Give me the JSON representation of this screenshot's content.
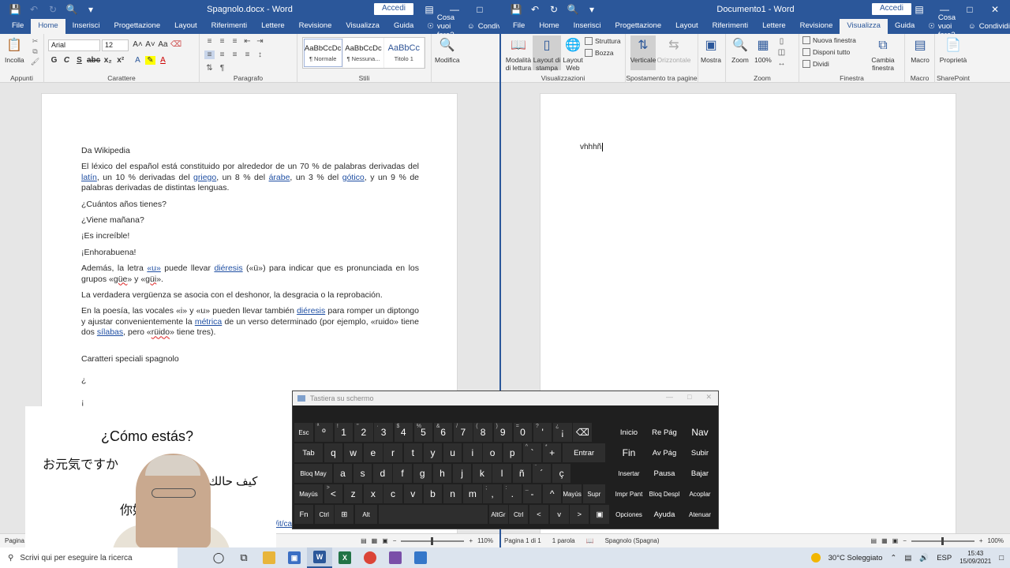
{
  "left_window": {
    "title": "Spagnolo.docx - Word",
    "accedi": "Accedi",
    "tabs": [
      "File",
      "Home",
      "Inserisci",
      "Progettazione",
      "Layout",
      "Riferimenti",
      "Lettere",
      "Revisione",
      "Visualizza",
      "Guida"
    ],
    "active_tab": "Home",
    "help": "Cosa vuoi fare?",
    "share": "Condividi",
    "ribbon": {
      "paste": "Incolla",
      "clipboard_group": "Appunti",
      "font_name": "Arial",
      "font_size": "12",
      "font_group": "Carattere",
      "paragraph_group": "Paragrafo",
      "styles": [
        {
          "preview": "AaBbCcDc",
          "name": "¶ Normale"
        },
        {
          "preview": "AaBbCcDc",
          "name": "¶ Nessuna..."
        },
        {
          "preview": "AaBbCc",
          "name": "Titolo 1"
        }
      ],
      "styles_group": "Stili",
      "edit": "Modifica"
    },
    "status": {
      "page": "Pagina",
      "zoom": "110%"
    },
    "document": {
      "p1": "Da Wikipedia",
      "p2": {
        "a": "El léxico del español está constituido por alrededor de un 70 % de palabras derivadas del ",
        "l1": "latín",
        "b": ", un 10 % derivadas del ",
        "l2": "griego",
        "c": ", un 8 % del ",
        "l3": "árabe",
        "d": ", un 3 % del ",
        "l4": "gótico",
        "e": ", y un 9 % de palabras derivadas de distintas lenguas."
      },
      "p3": "¿Cuántos años tienes?",
      "p4": "¿Viene mañana?",
      "p5": "¡Es increíble!",
      "p6": "¡Enhorabuena!",
      "p7": {
        "a": "Además, la letra ",
        "l1": "«u»",
        "b": " puede llevar ",
        "l2": "diéresis",
        "c": " («ü») para indicar que es pronunciada en los grupos «",
        "s1": "güe",
        "d": "» y «",
        "s2": "güi",
        "e": "»."
      },
      "p8": "La verdadera vergüenza se asocia con el deshonor, la desgracia o la reprobación.",
      "p9": {
        "a": "En la poesía, las vocales «i» y «u» pueden llevar también ",
        "l1": "diéresis",
        "b": " para romper un diptongo y ajustar convenientemente la ",
        "l2": "métrica",
        "c": " de un verso determinado (por ejemplo, «ruido» tiene dos ",
        "l3": "sílabas",
        "d": ", pero «",
        "s1": "rüido",
        "e": "» tiene tres)."
      },
      "p10": "Caratteri speciali spagnolo",
      "p11": "¿",
      "p12": "¡",
      "url_fragment": "/it/ca"
    }
  },
  "right_window": {
    "title": "Documento1 - Word",
    "accedi": "Accedi",
    "tabs": [
      "File",
      "Home",
      "Inserisci",
      "Progettazione",
      "Layout",
      "Riferimenti",
      "Lettere",
      "Revisione",
      "Visualizza",
      "Guida"
    ],
    "active_tab": "Visualizza",
    "help": "Cosa vuoi fare?",
    "share": "Condividi",
    "ribbon": {
      "reading_mode": "Modalità di lettura",
      "print_layout": "Layout di stampa",
      "web_layout": "Layout Web",
      "structure": "Struttura",
      "draft": "Bozza",
      "views_group": "Visualizzazioni",
      "vertical": "Verticale",
      "horizontal": "Orizzontale",
      "page_move_group": "Spostamento tra pagine",
      "show": "Mostra",
      "zoom": "Zoom",
      "zoom100": "100%",
      "zoom_group": "Zoom",
      "new_window": "Nuova finestra",
      "arrange_all": "Disponi tutto",
      "split": "Dividi",
      "switch_windows": "Cambia finestra",
      "window_group": "Finestra",
      "macro": "Macro",
      "macro_group": "Macro",
      "properties": "Proprietà",
      "sharepoint_group": "SharePoint"
    },
    "document_text": "vhhhñ",
    "status": {
      "page": "Pagina 1 di 1",
      "words": "1 parola",
      "language": "Spagnolo (Spagna)",
      "zoom": "100%"
    }
  },
  "keyboard": {
    "title": "Tastiera su schermo",
    "row1": [
      {
        "m": "Esc"
      },
      {
        "s": "ª",
        "m": "º"
      },
      {
        "s": "!",
        "m": "1"
      },
      {
        "s": "\"",
        "m": "2"
      },
      {
        "s": "·",
        "m": "3"
      },
      {
        "s": "$",
        "m": "4"
      },
      {
        "s": "%",
        "m": "5"
      },
      {
        "s": "&",
        "m": "6"
      },
      {
        "s": "/",
        "m": "7"
      },
      {
        "s": "(",
        "m": "8"
      },
      {
        "s": ")",
        "m": "9"
      },
      {
        "s": "=",
        "m": "0"
      },
      {
        "s": "?",
        "m": "'"
      },
      {
        "s": "¿",
        "m": "¡"
      },
      {
        "m": "⌫"
      }
    ],
    "row2": [
      {
        "m": "Tab"
      },
      {
        "m": "q"
      },
      {
        "m": "w"
      },
      {
        "m": "e"
      },
      {
        "m": "r"
      },
      {
        "m": "t"
      },
      {
        "m": "y"
      },
      {
        "m": "u"
      },
      {
        "m": "i"
      },
      {
        "m": "o"
      },
      {
        "m": "p"
      },
      {
        "s": "^",
        "m": "`"
      },
      {
        "s": "*",
        "m": "+"
      },
      {
        "m": "Entrar"
      }
    ],
    "row3": [
      {
        "m": "Bloq May"
      },
      {
        "m": "a"
      },
      {
        "m": "s"
      },
      {
        "m": "d"
      },
      {
        "m": "f"
      },
      {
        "m": "g"
      },
      {
        "m": "h"
      },
      {
        "m": "j"
      },
      {
        "m": "k"
      },
      {
        "m": "l"
      },
      {
        "m": "ñ"
      },
      {
        "s": "¨",
        "m": "´"
      },
      {
        "m": "ç"
      }
    ],
    "row4": [
      {
        "m": "Mayús"
      },
      {
        "s": ">",
        "m": "<"
      },
      {
        "m": "z"
      },
      {
        "m": "x"
      },
      {
        "m": "c"
      },
      {
        "m": "v"
      },
      {
        "m": "b"
      },
      {
        "m": "n"
      },
      {
        "m": "m"
      },
      {
        "s": ";",
        "m": ","
      },
      {
        "s": ":",
        "m": "."
      },
      {
        "s": "_",
        "m": "-"
      },
      {
        "m": "^"
      },
      {
        "m": "Mayús"
      },
      {
        "m": "Supr"
      }
    ],
    "row5": [
      {
        "m": "Fn"
      },
      {
        "m": "Ctrl"
      },
      {
        "m": "⊞"
      },
      {
        "m": "Alt"
      },
      {
        "m": " "
      },
      {
        "m": "AltGr"
      },
      {
        "m": "Ctrl"
      },
      {
        "m": "<"
      },
      {
        "m": "v"
      },
      {
        "m": ">"
      },
      {
        "m": "▣"
      }
    ],
    "nav": [
      [
        "Inicio",
        "Re Pág",
        "Nav"
      ],
      [
        "Fin",
        "Av Pág",
        "Subir"
      ],
      [
        "Insertar",
        "Pausa",
        "Bajar"
      ],
      [
        "Impr Pant",
        "Bloq Despl",
        "Acoplar"
      ],
      [
        "Opciones",
        "Ayuda",
        "Atenuar"
      ]
    ]
  },
  "webcam": {
    "spanish": "¿Cómo estás?",
    "japanese": "お元気ですか",
    "arabic": "كيف حالك؟",
    "chinese": "你好"
  },
  "taskbar": {
    "search_placeholder": "Scrivi qui per eseguire la ricerca",
    "weather": "30°C  Soleggiato",
    "language": "ESP",
    "time": "15:43",
    "date": "15/09/2021"
  }
}
